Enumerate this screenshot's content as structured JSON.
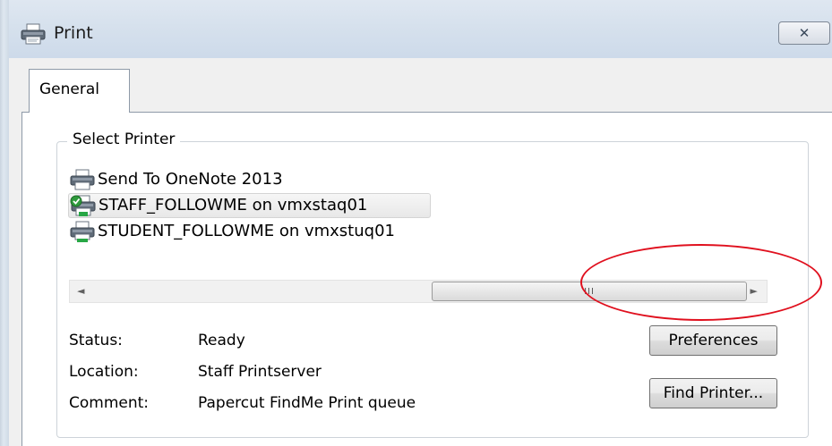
{
  "window": {
    "title": "Print",
    "close_icon": "close-icon"
  },
  "tabs": [
    {
      "label": "General",
      "active": true
    }
  ],
  "select_printer": {
    "group_label": "Select Printer",
    "printers": [
      {
        "name": "Send To OneNote 2013",
        "icon": "printer-icon",
        "selected": false
      },
      {
        "name": "STAFF_FOLLOWME on vmxstaq01",
        "icon": "default-printer-icon",
        "selected": true
      },
      {
        "name": "STUDENT_FOLLOWME on vmxstuq01",
        "icon": "network-printer-icon",
        "selected": false
      }
    ],
    "scrollbar": {
      "left_arrow": "◄",
      "right_arrow": "►",
      "thumb_grip": "III"
    },
    "status_label": "Status:",
    "status_value": "Ready",
    "location_label": "Location:",
    "location_value": "Staff Printserver",
    "comment_label": "Comment:",
    "comment_value": "Papercut FindMe Print queue",
    "preferences_button": "Preferences",
    "find_printer_button": "Find Printer..."
  },
  "annotation": {
    "highlight_color": "#e0101e"
  }
}
